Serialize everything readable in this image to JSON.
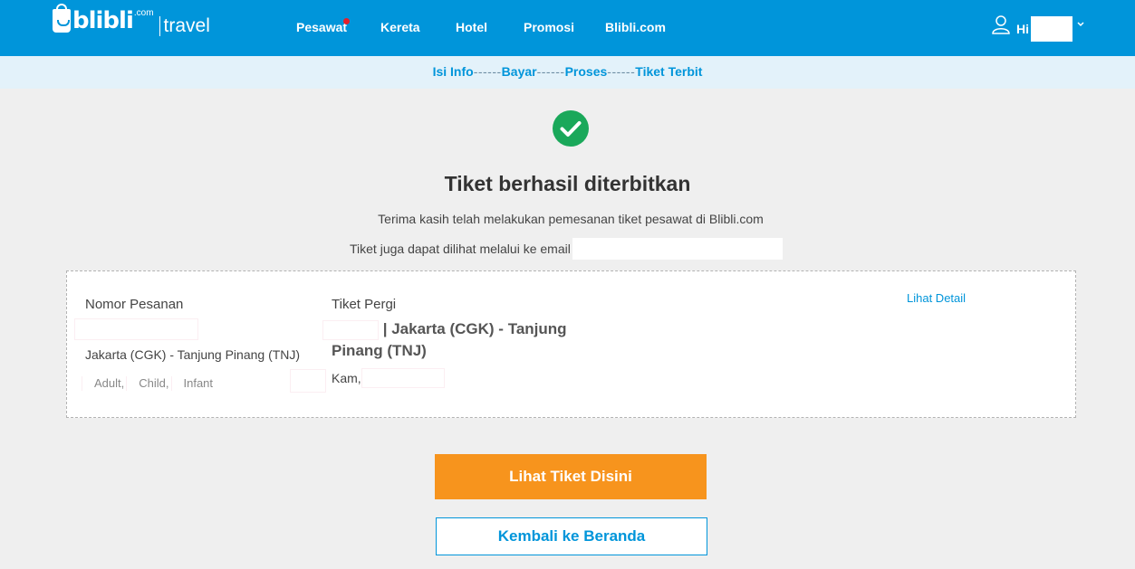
{
  "header": {
    "logo_word": "blibli",
    "logo_com": ".com",
    "logo_product": "travel",
    "nav": [
      {
        "label": "Pesawat",
        "has_dot": true
      },
      {
        "label": "Kereta"
      },
      {
        "label": "Hotel"
      },
      {
        "label": "Promosi"
      },
      {
        "label": "Blibli.com"
      }
    ],
    "user_greeting": "Hi",
    "user_icon": "user-outline-icon",
    "caret_icon": "chevron-down-icon"
  },
  "steps": [
    {
      "label": "Isi Info"
    },
    {
      "label": "Bayar"
    },
    {
      "label": "Proses"
    },
    {
      "label": "Tiket Terbit"
    }
  ],
  "step_separator": "------",
  "success": {
    "icon": "check-circle-icon",
    "title": "Tiket berhasil diterbitkan",
    "thanks": "Terima kasih telah melakukan pemesanan tiket pesawat di Blibli.com",
    "email_prefix": "Tiket juga dapat dilihat melalui ke email"
  },
  "order": {
    "order_label": "Nomor Pesanan",
    "route": "Jakarta (CGK) - Tanjung Pinang (TNJ)",
    "pax_adult": "Adult,",
    "pax_child": "Child,",
    "pax_infant": "Infant",
    "trip_label": "Tiket Pergi",
    "trip_route": "| Jakarta (CGK) - Tanjung Pinang (TNJ)",
    "trip_day": "Kam,",
    "detail_link": "Lihat Detail"
  },
  "actions": {
    "view_ticket": "Lihat Tiket Disini",
    "back_home": "Kembali ke Beranda"
  },
  "colors": {
    "brand_blue": "#0095da",
    "success_green": "#1aa85a",
    "cta_orange": "#f7941d"
  }
}
